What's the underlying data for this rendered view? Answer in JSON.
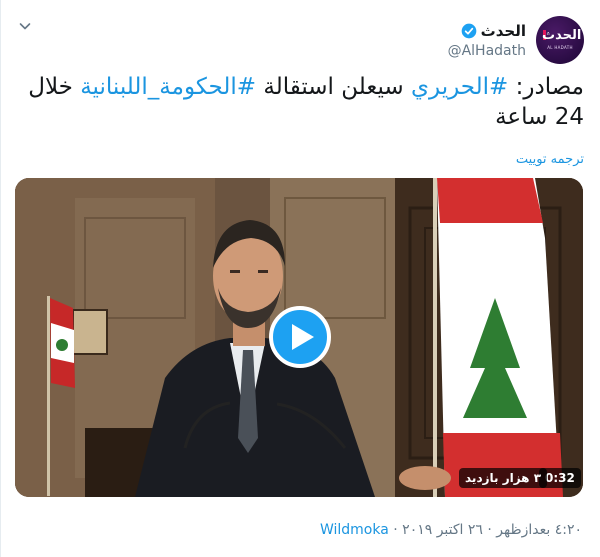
{
  "account": {
    "display_name": "الحدث",
    "handle": "@AlHadath",
    "avatar_text_ar": "الحدث",
    "avatar_text_en": "AL HADATH"
  },
  "tweet": {
    "text_parts": [
      {
        "text": "مصادر: ",
        "hashtag": false
      },
      {
        "text": "#الحريري",
        "hashtag": true
      },
      {
        "text": " سيعلن استقالة ",
        "hashtag": false
      },
      {
        "text": "#الحكومة_اللبنانية",
        "hashtag": true
      },
      {
        "text": " خلال 24 ساعة",
        "hashtag": false
      }
    ],
    "translate_label": "ترجمه توييت"
  },
  "video": {
    "duration": "0:32",
    "views": "٣ هزار بازدید"
  },
  "footer": {
    "time": "٤:٢٠ بعدازظهر",
    "date": "٢٦ اکتبر ٢٠١٩",
    "source": "Wildmoka",
    "separator": " · "
  },
  "colors": {
    "link": "#1b95e0",
    "play_button": "#1da1f2",
    "muted": "#657786"
  }
}
